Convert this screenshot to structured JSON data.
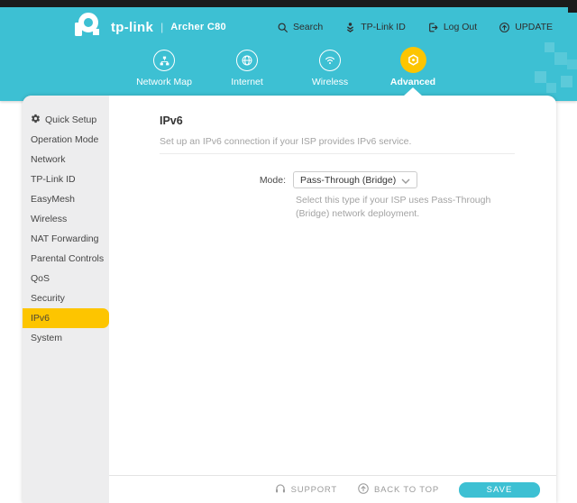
{
  "colors": {
    "accent_teal": "#3dc0d3",
    "brand_yellow": "#fdc500",
    "topbar_black": "#1b1b1b",
    "sidebar_gray": "#ededee"
  },
  "header": {
    "brand": {
      "name": "tp-link",
      "separator": "|",
      "model": "Archer C80"
    },
    "menu": [
      {
        "icon": "search-icon",
        "label": "Search"
      },
      {
        "icon": "tplink-id-icon",
        "label": "TP-Link ID"
      },
      {
        "icon": "logout-icon",
        "label": "Log Out"
      },
      {
        "icon": "update-icon",
        "label": "UPDATE"
      }
    ],
    "nav": [
      {
        "icon": "network-map-icon",
        "label": "Network Map",
        "active": false
      },
      {
        "icon": "internet-icon",
        "label": "Internet",
        "active": false
      },
      {
        "icon": "wireless-icon",
        "label": "Wireless",
        "active": false
      },
      {
        "icon": "advanced-icon",
        "label": "Advanced",
        "active": true
      }
    ]
  },
  "sidebar": {
    "items": [
      {
        "label": "Quick Setup",
        "icon": "quick-setup-icon",
        "active": false
      },
      {
        "label": "Operation Mode",
        "active": false
      },
      {
        "label": "Network",
        "active": false
      },
      {
        "label": "TP-Link ID",
        "active": false
      },
      {
        "label": "EasyMesh",
        "active": false
      },
      {
        "label": "Wireless",
        "active": false
      },
      {
        "label": "NAT Forwarding",
        "active": false
      },
      {
        "label": "Parental Controls",
        "active": false
      },
      {
        "label": "QoS",
        "active": false
      },
      {
        "label": "Security",
        "active": false
      },
      {
        "label": "IPv6",
        "active": true
      },
      {
        "label": "System",
        "active": false
      }
    ]
  },
  "main": {
    "title": "IPv6",
    "description": "Set up an IPv6 connection if your ISP provides IPv6 service.",
    "form": {
      "mode_label": "Mode:",
      "mode_value": "Pass-Through (Bridge)",
      "mode_hint": "Select this type if your ISP uses Pass-Through (Bridge) network deployment."
    }
  },
  "footer": {
    "support_label": "SUPPORT",
    "back_to_top_label": "BACK TO TOP",
    "save_label": "SAVE"
  }
}
